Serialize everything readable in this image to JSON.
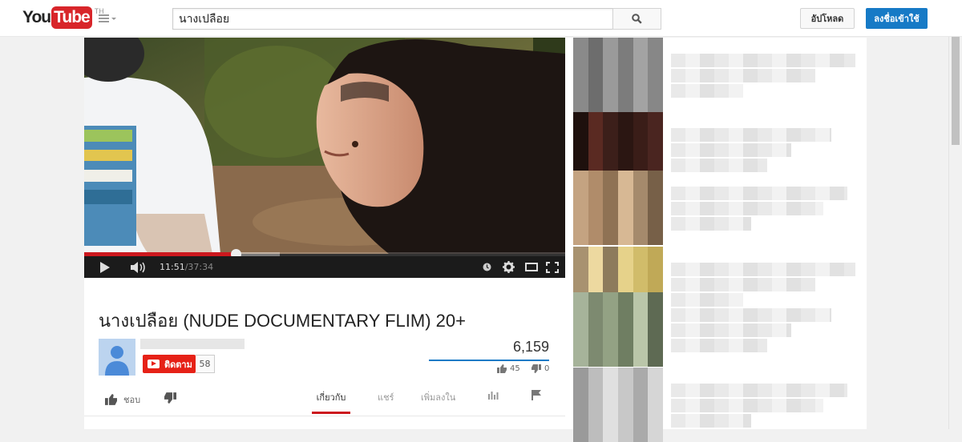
{
  "header": {
    "logo_you": "You",
    "logo_tube": "Tube",
    "logo_region": "TH",
    "search_value": "นางเปลือย",
    "upload_label": "อัปโหลด",
    "signin_label": "ลงชื่อเข้าใช้"
  },
  "player": {
    "time_current": "11:51",
    "time_separator": " / ",
    "time_total": "37:34",
    "progress_played_pct": 31.5,
    "progress_loaded_pct": 40.7,
    "progress_color": "#cc181e"
  },
  "video": {
    "title": "นางเปลือย (NUDE DOCUMENTARY FLIM) 20+",
    "view_count": "6,159",
    "like_count": "45",
    "dislike_count": "0",
    "subscribe_label": "ติดตาม",
    "subscriber_count": "58",
    "like_action_label": "ชอบ"
  },
  "tabs": [
    {
      "label": "เกี่ยวกับ",
      "active": true
    },
    {
      "label": "แชร์",
      "active": false
    },
    {
      "label": "เพิ่มลงใน",
      "active": false
    }
  ],
  "colors": {
    "brand_red": "#e62117",
    "accent_blue": "#167ac6"
  }
}
